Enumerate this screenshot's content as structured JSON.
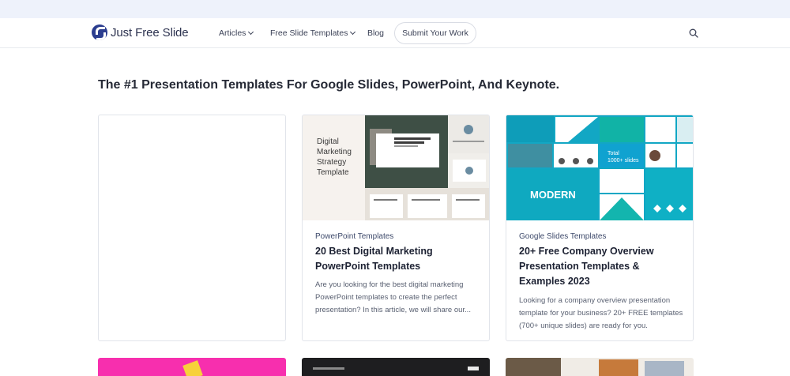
{
  "site": {
    "name": "Just Free Slide"
  },
  "nav": {
    "articles": "Articles",
    "free_templates": "Free Slide Templates",
    "blog": "Blog",
    "submit": "Submit Your Work"
  },
  "headline": "The #1 Presentation Templates For Google Slides, PowerPoint, And Keynote.",
  "cards": [
    {
      "category": "PowerPoint Templates",
      "title": "20 Best Digital Marketing PowerPoint Templates",
      "excerpt": "Are you looking for the best digital marketing PowerPoint templates to create the perfect presentation? In this article, we will share our...",
      "thumb_title": "Digital Marketing Strategy Template"
    },
    {
      "category": "Google Slides Templates",
      "title": "20+ Free Company Overview Presentation Templates & Examples 2023",
      "excerpt": "Looking for a company overview presentation template for your business? 20+ FREE templates (700+ unique slides) are ready for you.",
      "thumb_big": "MODERN",
      "thumb_total": "Total 1000+ slides"
    }
  ],
  "colors": {
    "brand": "#2b3d8f",
    "pink": "#f72fae",
    "teal": "#12a7c4"
  }
}
